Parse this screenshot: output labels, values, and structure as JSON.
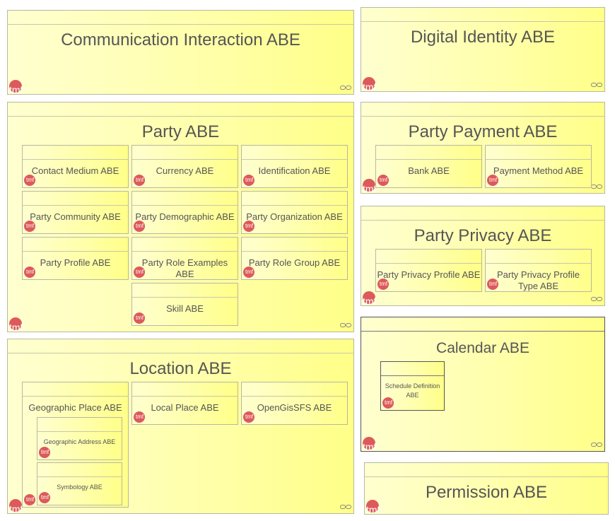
{
  "tmf_label": "tmf",
  "boxes": {
    "communication_interaction": "Communication Interaction ABE",
    "digital_identity": "Digital Identity ABE",
    "party": "Party ABE",
    "party_payment": "Party Payment ABE",
    "party_privacy": "Party Privacy ABE",
    "location": "Location ABE",
    "calendar": "Calendar ABE",
    "permission": "Permission ABE"
  },
  "party_children": {
    "contact_medium": "Contact Medium ABE",
    "currency": "Currency ABE",
    "identification": "Identification ABE",
    "party_community": "Party Community ABE",
    "party_demographic": "Party Demographic ABE",
    "party_organization": "Party Organization ABE",
    "party_profile": "Party Profile ABE",
    "party_role_examples": "Party Role Examples ABE",
    "party_role_group": "Party Role Group ABE",
    "skill": "Skill ABE"
  },
  "party_payment_children": {
    "bank": "Bank ABE",
    "payment_method": "Payment Method ABE"
  },
  "party_privacy_children": {
    "privacy_profile": "Party Privacy Profile ABE",
    "privacy_profile_type": "Party Privacy Profile Type ABE"
  },
  "location_children": {
    "geographic_place": "Geographic Place ABE",
    "local_place": "Local Place ABE",
    "opengis": "OpenGisSFS ABE",
    "geographic_address": "Geographic Address ABE",
    "symbology": "Symbology ABE"
  },
  "calendar_children": {
    "schedule_definition": "Schedule Definition ABE"
  }
}
